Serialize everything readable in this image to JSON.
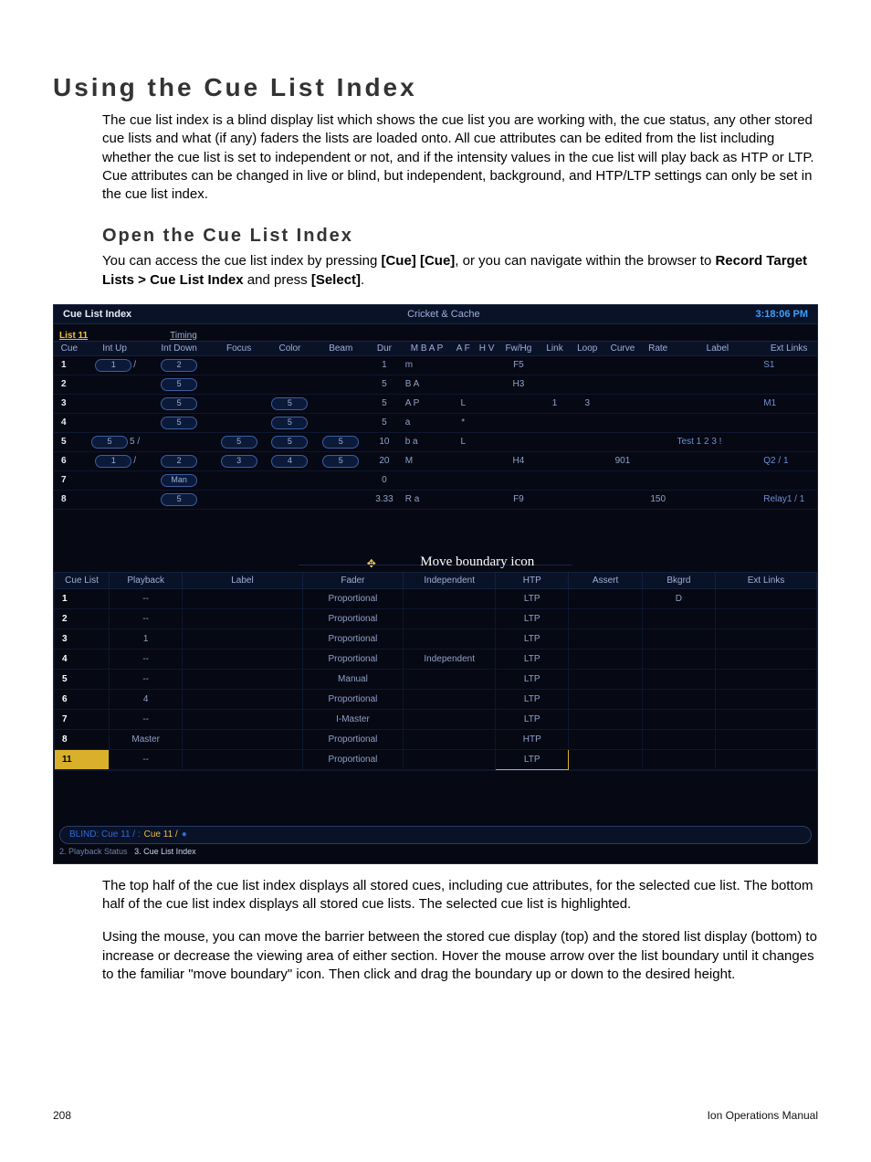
{
  "page": {
    "title": "Using the Cue List Index",
    "intro": "The cue list index is a blind display list which shows the cue list you are working with, the cue status, any other stored cue lists and what (if any) faders the lists are loaded onto. All cue attributes can be edited from the list including whether the cue list is set to independent or not, and if the intensity values in the cue list will play back as HTP or LTP. Cue attributes can be changed in live or blind, but independent, background, and HTP/LTP settings can only be set in the cue list index.",
    "sub_title": "Open the Cue List Index",
    "sub_para_1a": "You can access the cue list index by pressing ",
    "sub_para_1b": "[Cue] [Cue]",
    "sub_para_1c": ", or you can navigate within the browser to ",
    "sub_para_1d": "Record Target Lists > Cue List Index",
    "sub_para_1e": " and press ",
    "sub_para_1f": "[Select]",
    "sub_para_1g": ".",
    "after_1": "The top half of the cue list index displays all stored cues, including cue attributes, for the selected cue list. The bottom half of the cue list index displays all stored cue lists. The selected cue list is highlighted.",
    "after_2": "Using the mouse, you can move the barrier between the stored cue display (top) and the stored list display (bottom) to increase or decrease the viewing area of either section. Hover the mouse arrow over the list boundary until it changes to the familiar \"move boundary\" icon. Then click and drag the boundary up or down to the desired height.",
    "footer_page": "208",
    "footer_manual": "Ion Operations Manual"
  },
  "figure": {
    "title": "Cue List Index",
    "center": "Cricket & Cache",
    "clock": "3:18:06 PM",
    "list_label": "List 11",
    "timing_label": "Timing",
    "boundary_label": "Move boundary icon",
    "top_headers": [
      "Cue",
      "Int Up",
      "Int Down",
      "Focus",
      "Color",
      "Beam",
      "Dur",
      "M B A P",
      "A F",
      "H V",
      "Fw/Hg",
      "Link",
      "Loop",
      "Curve",
      "Rate",
      "Label",
      "Ext Links"
    ],
    "top_rows": [
      {
        "cue": "1",
        "intup": "1",
        "intup2": "/",
        "intdown": "2",
        "focus": "",
        "color": "",
        "beam": "",
        "dur": "1",
        "mbap": "m",
        "af": "",
        "hv": "",
        "fwhg": "F5",
        "link": "",
        "loop": "",
        "curve": "",
        "rate": "",
        "label": "",
        "ext": "S1"
      },
      {
        "cue": "2",
        "intup": "",
        "intup2": "",
        "intdown": "5",
        "focus": "",
        "color": "",
        "beam": "",
        "dur": "5",
        "mbap": "B A",
        "af": "",
        "hv": "",
        "fwhg": "H3",
        "link": "",
        "loop": "",
        "curve": "",
        "rate": "",
        "label": "",
        "ext": ""
      },
      {
        "cue": "3",
        "intup": "",
        "intup2": "",
        "intdown": "5",
        "focus": "",
        "color": "5",
        "beam": "",
        "dur": "5",
        "mbap": "A P",
        "af": "L",
        "hv": "",
        "fwhg": "",
        "link": "1",
        "loop": "3",
        "curve": "",
        "rate": "",
        "label": "",
        "ext": "M1"
      },
      {
        "cue": "4",
        "intup": "",
        "intup2": "",
        "intdown": "5",
        "focus": "",
        "color": "5",
        "beam": "",
        "dur": "5",
        "mbap": "a",
        "af": "*",
        "hv": "",
        "fwhg": "",
        "link": "",
        "loop": "",
        "curve": "",
        "rate": "",
        "label": "",
        "ext": ""
      },
      {
        "cue": "5",
        "intup": "5",
        "intup2": "5   /",
        "intdown": "",
        "focus": "5",
        "color": "5",
        "beam": "5",
        "dur": "10",
        "mbap": "b a",
        "af": "L",
        "hv": "",
        "fwhg": "",
        "link": "",
        "loop": "",
        "curve": "",
        "rate": "",
        "label": "Test 1 2 3 !",
        "ext": ""
      },
      {
        "cue": "6",
        "intup": "1",
        "intup2": "/",
        "intdown": "2",
        "focus": "3",
        "color": "4",
        "beam": "5",
        "dur": "20",
        "mbap": "M",
        "af": "",
        "hv": "",
        "fwhg": "H4",
        "link": "",
        "loop": "",
        "curve": "901",
        "rate": "",
        "label": "",
        "ext": "Q2 / 1"
      },
      {
        "cue": "7",
        "intup": "",
        "intup2": "",
        "intdown": "Man",
        "focus": "",
        "color": "",
        "beam": "",
        "dur": "0",
        "mbap": "",
        "af": "",
        "hv": "",
        "fwhg": "",
        "link": "",
        "loop": "",
        "curve": "",
        "rate": "",
        "label": "",
        "ext": ""
      },
      {
        "cue": "8",
        "intup": "",
        "intup2": "",
        "intdown": "5",
        "focus": "",
        "color": "",
        "beam": "",
        "dur": "3.33",
        "mbap": "R   a",
        "af": "",
        "hv": "",
        "fwhg": "F9",
        "link": "",
        "loop": "",
        "curve": "",
        "rate": "150",
        "label": "",
        "ext": "Relay1 / 1"
      }
    ],
    "bot_headers": [
      "Cue List",
      "Playback",
      "Label",
      "Fader",
      "Independent",
      "HTP",
      "Assert",
      "Bkgrd",
      "Ext Links"
    ],
    "bot_rows": [
      {
        "n": "1",
        "pb": "--",
        "lbl": "",
        "fader": "Proportional",
        "ind": "",
        "htp": "LTP",
        "assert": "",
        "bkgrd": "D",
        "ext": ""
      },
      {
        "n": "2",
        "pb": "--",
        "lbl": "",
        "fader": "Proportional",
        "ind": "",
        "htp": "LTP",
        "assert": "",
        "bkgrd": "",
        "ext": ""
      },
      {
        "n": "3",
        "pb": "1",
        "lbl": "",
        "fader": "Proportional",
        "ind": "",
        "htp": "LTP",
        "assert": "",
        "bkgrd": "",
        "ext": ""
      },
      {
        "n": "4",
        "pb": "--",
        "lbl": "",
        "fader": "Proportional",
        "ind": "Independent",
        "htp": "LTP",
        "assert": "",
        "bkgrd": "",
        "ext": ""
      },
      {
        "n": "5",
        "pb": "--",
        "lbl": "",
        "fader": "Manual",
        "ind": "",
        "htp": "LTP",
        "assert": "",
        "bkgrd": "",
        "ext": ""
      },
      {
        "n": "6",
        "pb": "4",
        "lbl": "",
        "fader": "Proportional",
        "ind": "",
        "htp": "LTP",
        "assert": "",
        "bkgrd": "",
        "ext": ""
      },
      {
        "n": "7",
        "pb": "--",
        "lbl": "",
        "fader": "I-Master",
        "ind": "",
        "htp": "LTP",
        "assert": "",
        "bkgrd": "",
        "ext": ""
      },
      {
        "n": "8",
        "pb": "Master",
        "lbl": "",
        "fader": "Proportional",
        "ind": "",
        "htp": "HTP",
        "assert": "",
        "bkgrd": "",
        "ext": ""
      },
      {
        "n": "11",
        "pb": "--",
        "lbl": "",
        "fader": "Proportional",
        "ind": "",
        "htp": "LTP",
        "assert": "",
        "bkgrd": "",
        "ext": "",
        "selected": true
      }
    ],
    "cmd_blind": "BLIND: Cue  11 / :",
    "cmd_gold": "Cue 11 /",
    "cmd_dot": "●",
    "tab1": "2. Playback Status",
    "tab2": "3. Cue List Index"
  }
}
